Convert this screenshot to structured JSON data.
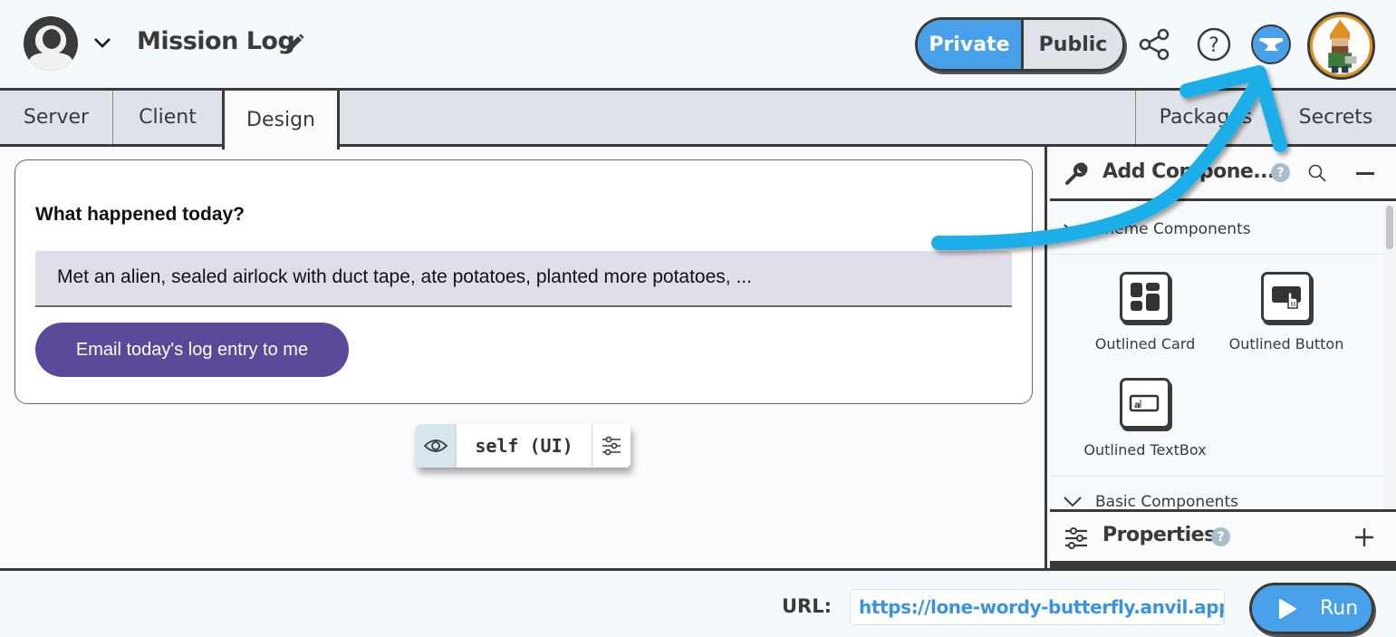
{
  "header": {
    "app_title": "Mission Log",
    "visibility": {
      "options": [
        "Private",
        "Public"
      ],
      "selected": "Private"
    },
    "icons": [
      "astronaut-logo",
      "chevron-down-icon",
      "pencil-icon",
      "share-icon",
      "help-icon",
      "anvil-icon",
      "avatar"
    ]
  },
  "tabs": [
    {
      "label": "Server",
      "active": false
    },
    {
      "label": "Client",
      "active": false
    },
    {
      "label": "Design",
      "active": true
    },
    {
      "label": "Packages",
      "active": false
    },
    {
      "label": "Secrets",
      "active": false
    }
  ],
  "canvas": {
    "form": {
      "label": "What happened today?",
      "textbox_value": "Met an alien, sealed airlock with duct tape, ate potatoes, planted more potatoes, ...",
      "button_label": "Email today's log entry to me"
    },
    "selection_bar": {
      "name": "self (UI)"
    }
  },
  "panel": {
    "title": "Add Compone...",
    "help_badge": "?",
    "sections": [
      {
        "title": "Theme Components",
        "items": [
          "Outlined Card",
          "Outlined Button",
          "Outlined TextBox"
        ]
      },
      {
        "title": "Basic Components",
        "items": []
      }
    ],
    "properties": {
      "title": "Properties",
      "help_badge": "?"
    }
  },
  "footer": {
    "url_label": "URL:",
    "url_value": "https://lone-wordy-butterfly.anvil.app",
    "run_label": "Run"
  },
  "colors": {
    "accent_blue": "#48a0e8",
    "button_purple": "#5c4898",
    "annotation_arrow": "#1eaee8",
    "border_dark": "#3a3a3a",
    "tab_bg": "#dde3e9",
    "input_bg": "#e0dce8",
    "url_text": "#3a93e0"
  }
}
